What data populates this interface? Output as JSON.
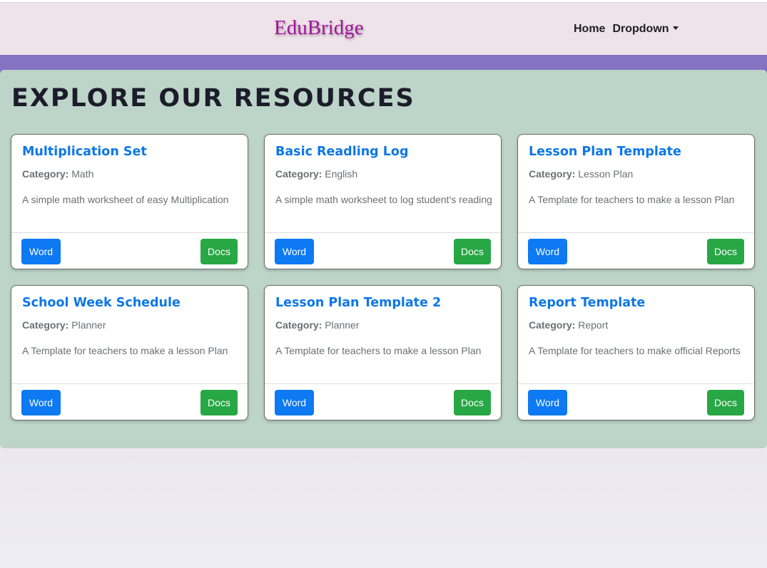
{
  "navbar": {
    "brand": "EduBridge",
    "links": [
      {
        "label": "Home"
      },
      {
        "label": "Dropdown"
      }
    ]
  },
  "main": {
    "title": "EXPLORE OUR RESOURCES",
    "category_prefix": "Category:",
    "cards": [
      {
        "title": "Multiplication Set",
        "category": "Math",
        "description": "A simple math worksheet of easy Multiplication",
        "word_label": "Word",
        "docs_label": "Docs"
      },
      {
        "title": "Basic Readling Log",
        "category": "English",
        "description": "A simple math worksheet to log student's reading",
        "word_label": "Word",
        "docs_label": "Docs"
      },
      {
        "title": "Lesson Plan Template",
        "category": "Lesson Plan",
        "description": "A Template for teachers to make a lesson Plan",
        "word_label": "Word",
        "docs_label": "Docs"
      },
      {
        "title": "School Week Schedule",
        "category": "Planner",
        "description": "A Template for teachers to make a lesson Plan",
        "word_label": "Word",
        "docs_label": "Docs"
      },
      {
        "title": "Lesson Plan Template 2",
        "category": "Planner",
        "description": "A Template for teachers to make a lesson Plan",
        "word_label": "Word",
        "docs_label": "Docs"
      },
      {
        "title": "Report Template",
        "category": "Report",
        "description": "A Template for teachers to make official Reports",
        "word_label": "Word",
        "docs_label": "Docs"
      }
    ]
  },
  "colors": {
    "brand": "#a4139a",
    "card_title": "#0d77e6",
    "word_button": "#0d79f3",
    "docs_button": "#28a745",
    "panel": "#bdd4c8",
    "band": "#8472c2",
    "navbar": "#efe3ea"
  },
  "icons": {
    "dropdown": "caret-down-icon"
  }
}
